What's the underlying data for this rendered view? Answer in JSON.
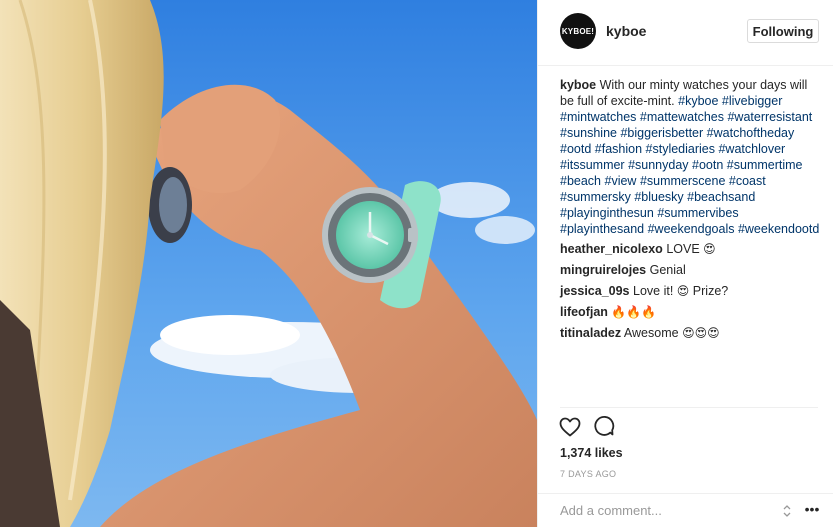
{
  "post": {
    "avatar_text": "KYBOE!",
    "username": "kyboe",
    "follow_label": "Following",
    "caption": {
      "author": "kyboe",
      "text": "With our minty watches your days will be full of excite-mint.",
      "hashtags": [
        "#kyboe",
        "#livebigger",
        "#mintwatches",
        "#mattewatches",
        "#waterresistant",
        "#sunshine",
        "#biggerisbetter",
        "#watchoftheday",
        "#ootd",
        "#fashion",
        "#stylediaries",
        "#watchlover",
        "#itssummer",
        "#sunnyday",
        "#ootn",
        "#summertime",
        "#beach",
        "#view",
        "#summerscene",
        "#coast",
        "#summersky",
        "#bluesky",
        "#beachsand",
        "#playinginthesun",
        "#summervibes",
        "#playinthesand",
        "#weekendgoals",
        "#weekendootd"
      ]
    },
    "comments": [
      {
        "user": "heather_nicolexo",
        "text": "LOVE",
        "emoji": "😍"
      },
      {
        "user": "mingruirelojes",
        "text": "Genial",
        "emoji": ""
      },
      {
        "user": "jessica_09s",
        "text": "Love it!",
        "emoji": "😍",
        "after": "Prize?"
      },
      {
        "user": "lifeofjan",
        "text": "",
        "emoji": "🔥🔥🔥"
      },
      {
        "user": "titinaladez",
        "text": "Awesome",
        "emoji": "😍😍😍"
      }
    ],
    "likes": "1,374 likes",
    "time_ago": "7 DAYS AGO",
    "comment_placeholder": "Add a comment...",
    "icons": [
      "heart-icon",
      "comment-icon",
      "more-options-icon"
    ]
  },
  "colors": {
    "hashtag": "#003569",
    "sky": "#3f8fe6",
    "watch_mint": "#7fdcc2"
  }
}
